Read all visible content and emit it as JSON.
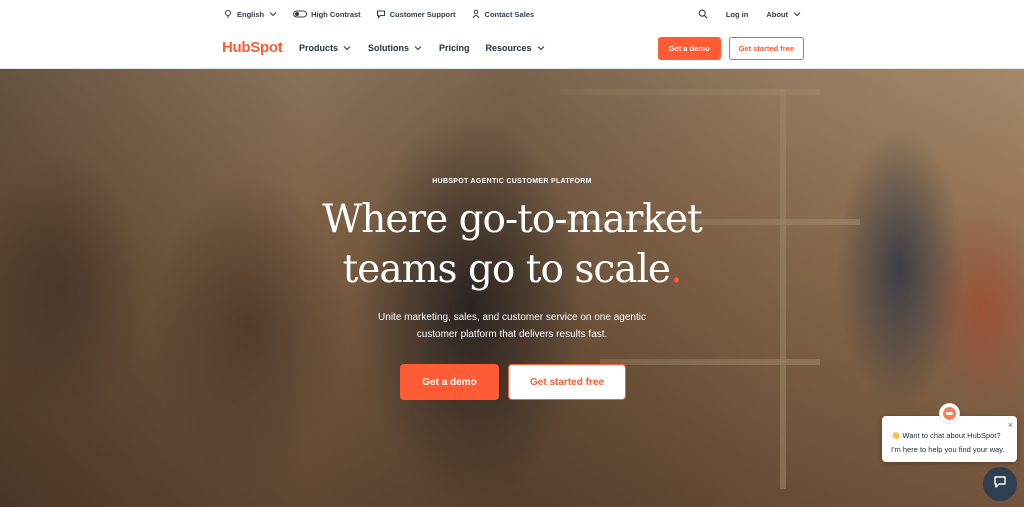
{
  "utility": {
    "language": "English",
    "contrast": "High Contrast",
    "support": "Customer Support",
    "sales": "Contact Sales",
    "login": "Log in",
    "about": "About"
  },
  "brand": {
    "logo": "HubSpot",
    "accent": "#ff5c35",
    "dark": "#213343"
  },
  "nav": {
    "items": [
      {
        "label": "Products",
        "dropdown": true
      },
      {
        "label": "Solutions",
        "dropdown": true
      },
      {
        "label": "Pricing",
        "dropdown": false
      },
      {
        "label": "Resources",
        "dropdown": true
      }
    ],
    "demo": "Get a demo",
    "start": "Get started free"
  },
  "hero": {
    "eyebrow": "HUBSPOT AGENTIC CUSTOMER PLATFORM",
    "headline_line1": "Where go-to-market",
    "headline_line2": "teams go to scale",
    "headline_dot": ".",
    "subtext": "Unite marketing, sales, and customer service on one agentic customer platform that delivers results fast.",
    "demo": "Get a demo",
    "start": "Get started free"
  },
  "chat": {
    "line1": "👋 Want to chat about HubSpot?",
    "line2": "I'm here to help you find your way.",
    "close": "×"
  },
  "icons": [
    "globe-icon",
    "contrast-toggle-icon",
    "chat-bubble-icon",
    "person-icon",
    "search-icon",
    "chevron-down-icon",
    "close-icon",
    "chat-launcher-icon"
  ]
}
